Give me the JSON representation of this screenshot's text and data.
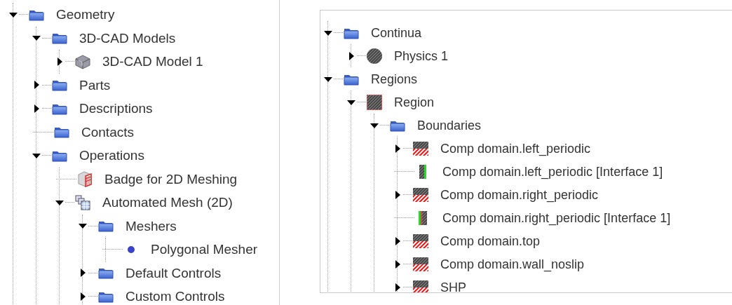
{
  "left_tree": [
    {
      "label": "Geometry",
      "kind": "folder",
      "expanded": true,
      "children": [
        {
          "label": "3D-CAD Models",
          "kind": "folder",
          "expanded": true,
          "children": [
            {
              "label": "3D-CAD Model 1",
              "kind": "cad-model",
              "expanded": false
            }
          ]
        },
        {
          "label": "Parts",
          "kind": "folder",
          "expanded": false
        },
        {
          "label": "Descriptions",
          "kind": "folder",
          "expanded": false
        },
        {
          "label": "Contacts",
          "kind": "folder"
        },
        {
          "label": "Operations",
          "kind": "folder",
          "expanded": true,
          "children": [
            {
              "label": "Badge for 2D Meshing",
              "kind": "badge"
            },
            {
              "label": "Automated Mesh (2D)",
              "kind": "automated-mesh",
              "expanded": true,
              "children": [
                {
                  "label": "Meshers",
                  "kind": "folder",
                  "expanded": true,
                  "children": [
                    {
                      "label": "Polygonal Mesher",
                      "kind": "mesher"
                    }
                  ]
                },
                {
                  "label": "Default Controls",
                  "kind": "folder",
                  "expanded": false
                },
                {
                  "label": "Custom Controls",
                  "kind": "folder",
                  "expanded": false
                }
              ]
            }
          ]
        }
      ]
    }
  ],
  "right_tree": [
    {
      "label": "Continua",
      "kind": "folder",
      "expanded": true,
      "children": [
        {
          "label": "Physics 1",
          "kind": "physics",
          "expanded": false
        }
      ]
    },
    {
      "label": "Regions",
      "kind": "folder",
      "expanded": true,
      "children": [
        {
          "label": "Region",
          "kind": "region",
          "expanded": true,
          "children": [
            {
              "label": "Boundaries",
              "kind": "folder",
              "expanded": true,
              "children": [
                {
                  "label": "Comp domain.left_periodic",
                  "kind": "boundary",
                  "expanded": false
                },
                {
                  "label": "Comp domain.left_periodic [Interface 1]",
                  "kind": "interface-left"
                },
                {
                  "label": "Comp domain.right_periodic",
                  "kind": "boundary",
                  "expanded": false
                },
                {
                  "label": "Comp domain.right_periodic [Interface 1]",
                  "kind": "interface-right"
                },
                {
                  "label": "Comp domain.top",
                  "kind": "boundary",
                  "expanded": false
                },
                {
                  "label": "Comp domain.wall_noslip",
                  "kind": "boundary",
                  "expanded": false
                },
                {
                  "label": "SHP",
                  "kind": "boundary",
                  "expanded": false
                }
              ]
            }
          ]
        }
      ]
    }
  ]
}
